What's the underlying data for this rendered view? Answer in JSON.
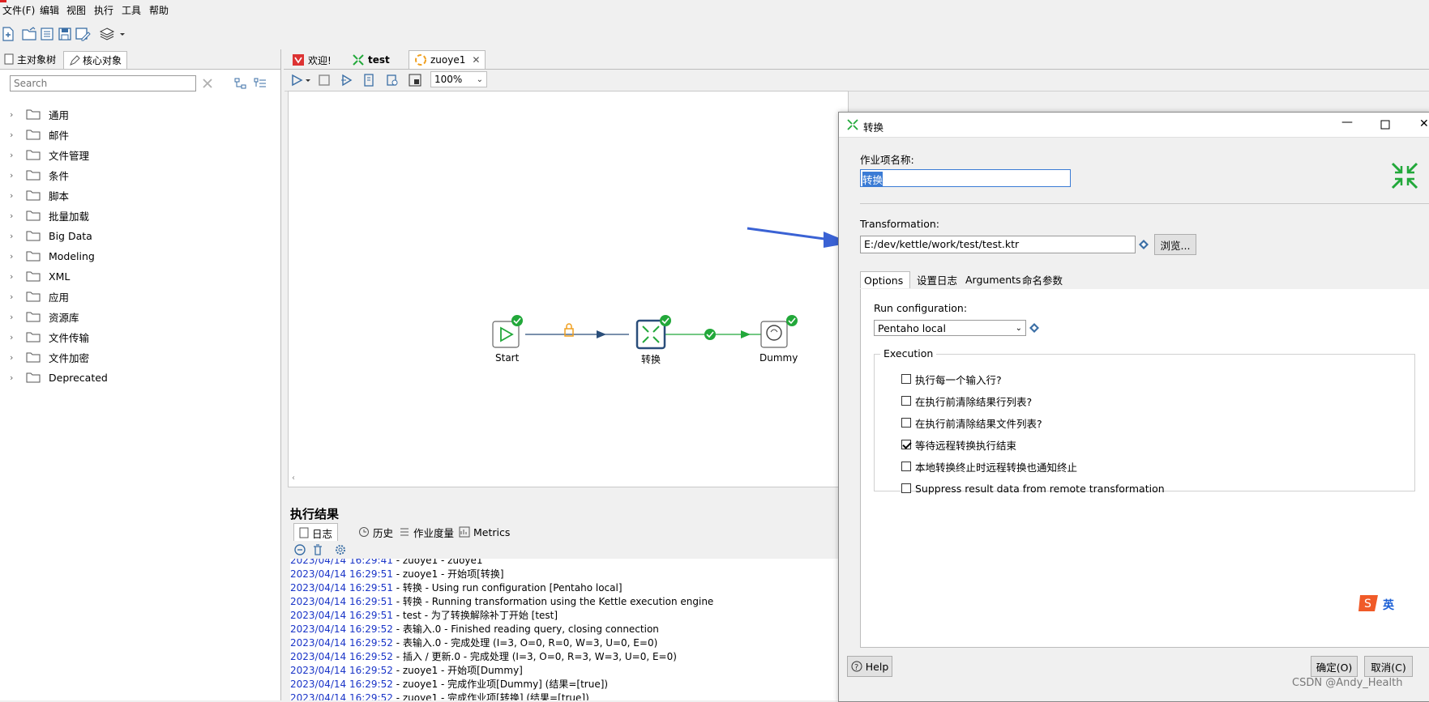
{
  "menu": [
    "文件(F)",
    "编辑",
    "视图",
    "执行",
    "工具",
    "帮助"
  ],
  "left": {
    "tabs": [
      "主对象树",
      "核心对象"
    ],
    "search_placeholder": "Search",
    "tree": [
      "通用",
      "邮件",
      "文件管理",
      "条件",
      "脚本",
      "批量加载",
      "Big Data",
      "Modeling",
      "XML",
      "应用",
      "资源库",
      "文件传输",
      "文件加密",
      "Deprecated"
    ]
  },
  "center": {
    "tabs": [
      "欢迎!",
      "test",
      "zuoye1"
    ],
    "zoom": "100%",
    "nodes": [
      "Start",
      "转换",
      "Dummy"
    ]
  },
  "results": {
    "title": "执行结果",
    "tabs": [
      "日志",
      "历史",
      "作业度量",
      "Metrics"
    ],
    "log": [
      {
        "ts": "2023/04/14 16:29:41",
        "msg": " - zuoye1 - zuoye1"
      },
      {
        "ts": "2023/04/14 16:29:51",
        "msg": " - zuoye1 - 开始项[转换]"
      },
      {
        "ts": "2023/04/14 16:29:51",
        "msg": " - 转换 - Using run configuration [Pentaho local]"
      },
      {
        "ts": "2023/04/14 16:29:51",
        "msg": " - 转换 - Running transformation using the Kettle execution engine"
      },
      {
        "ts": "2023/04/14 16:29:51",
        "msg": " - test - 为了转换解除补丁开始  [test]"
      },
      {
        "ts": "2023/04/14 16:29:52",
        "msg": " - 表输入.0 - Finished reading query, closing connection"
      },
      {
        "ts": "2023/04/14 16:29:52",
        "msg": " - 表输入.0 - 完成处理 (I=3, O=0, R=0, W=3, U=0, E=0)"
      },
      {
        "ts": "2023/04/14 16:29:52",
        "msg": " - 插入 / 更新.0 - 完成处理 (I=3, O=0, R=3, W=3, U=0, E=0)"
      },
      {
        "ts": "2023/04/14 16:29:52",
        "msg": " - zuoye1 - 开始项[Dummy]"
      },
      {
        "ts": "2023/04/14 16:29:52",
        "msg": " - zuoye1 - 完成作业项[Dummy] (结果=[true])"
      },
      {
        "ts": "2023/04/14 16:29:52",
        "msg": " - zuoye1 - 完成作业项[转换] (结果=[true])"
      }
    ]
  },
  "dialog": {
    "title": "转换",
    "name_label": "作业项名称:",
    "name_value": "转换",
    "transformation_label": "Transformation:",
    "transformation_value": "E:/dev/kettle/work/test/test.ktr",
    "browse": "浏览...",
    "tabs": [
      "Options",
      "设置日志",
      "Arguments",
      "命名参数"
    ],
    "run_config_label": "Run configuration:",
    "run_config_value": "Pentaho local",
    "execution_label": "Execution",
    "options": [
      {
        "label": "执行每一个输入行?",
        "checked": false
      },
      {
        "label": "在执行前清除结果行列表?",
        "checked": false
      },
      {
        "label": "在执行前清除结果文件列表?",
        "checked": false
      },
      {
        "label": "等待远程转换执行结束",
        "checked": true
      },
      {
        "label": "本地转换终止时远程转换也通知终止",
        "checked": false
      },
      {
        "label": "Suppress result data from remote transformation",
        "checked": false
      }
    ],
    "help": "Help",
    "ok": "确定(O)",
    "cancel": "取消(C)",
    "ime_label": "英"
  },
  "watermark": "CSDN @Andy_Health",
  "colors": {
    "accent_blue": "#3a62d4",
    "success_green": "#22a83a",
    "timestamp_blue": "#1a35c8"
  }
}
